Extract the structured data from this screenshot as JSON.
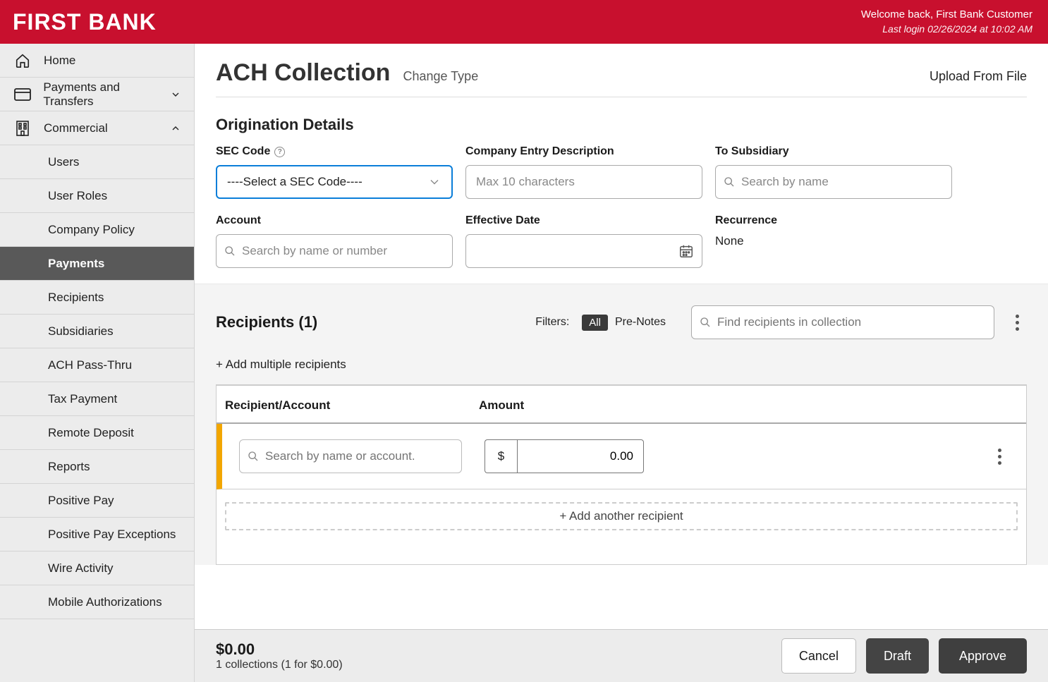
{
  "header": {
    "logo": "FIRST BANK",
    "welcome": "Welcome back, First Bank Customer",
    "last_login": "Last login 02/26/2024 at 10:02 AM"
  },
  "sidebar": {
    "items": [
      {
        "label": "Home"
      },
      {
        "label": "Payments and Transfers"
      },
      {
        "label": "Commercial"
      },
      {
        "label": "Users"
      },
      {
        "label": "User Roles"
      },
      {
        "label": "Company Policy"
      },
      {
        "label": "Payments"
      },
      {
        "label": "Recipients"
      },
      {
        "label": "Subsidiaries"
      },
      {
        "label": "ACH Pass-Thru"
      },
      {
        "label": "Tax Payment"
      },
      {
        "label": "Remote Deposit"
      },
      {
        "label": "Reports"
      },
      {
        "label": "Positive Pay"
      },
      {
        "label": "Positive Pay Exceptions"
      },
      {
        "label": "Wire Activity"
      },
      {
        "label": "Mobile Authorizations"
      }
    ]
  },
  "page": {
    "title": "ACH Collection",
    "change_type": "Change Type",
    "upload": "Upload From File"
  },
  "origination": {
    "section_title": "Origination Details",
    "labels": {
      "sec_code": "SEC Code",
      "company_entry": "Company Entry Description",
      "to_subsidiary": "To Subsidiary",
      "account": "Account",
      "effective_date": "Effective Date",
      "recurrence": "Recurrence"
    },
    "sec_code_value": "----Select a SEC Code----",
    "company_entry_placeholder": "Max 10 characters",
    "to_subsidiary_placeholder": "Search by name",
    "account_placeholder": "Search by name or number",
    "effective_date_value": "",
    "recurrence_value": "None"
  },
  "recipients": {
    "title": "Recipients (1)",
    "filters_label": "Filters:",
    "filter_all": "All",
    "filter_prenotes": "Pre-Notes",
    "search_placeholder": "Find recipients in collection",
    "add_multiple": "+ Add multiple recipients",
    "col_recipient": "Recipient/Account",
    "col_amount": "Amount",
    "row_search_placeholder": "Search by name or account.",
    "currency_symbol": "$",
    "amount_value": "0.00",
    "add_another": "+ Add another recipient"
  },
  "footer": {
    "total": "$0.00",
    "summary": "1 collections (1 for $0.00)",
    "cancel": "Cancel",
    "draft": "Draft",
    "approve": "Approve"
  }
}
